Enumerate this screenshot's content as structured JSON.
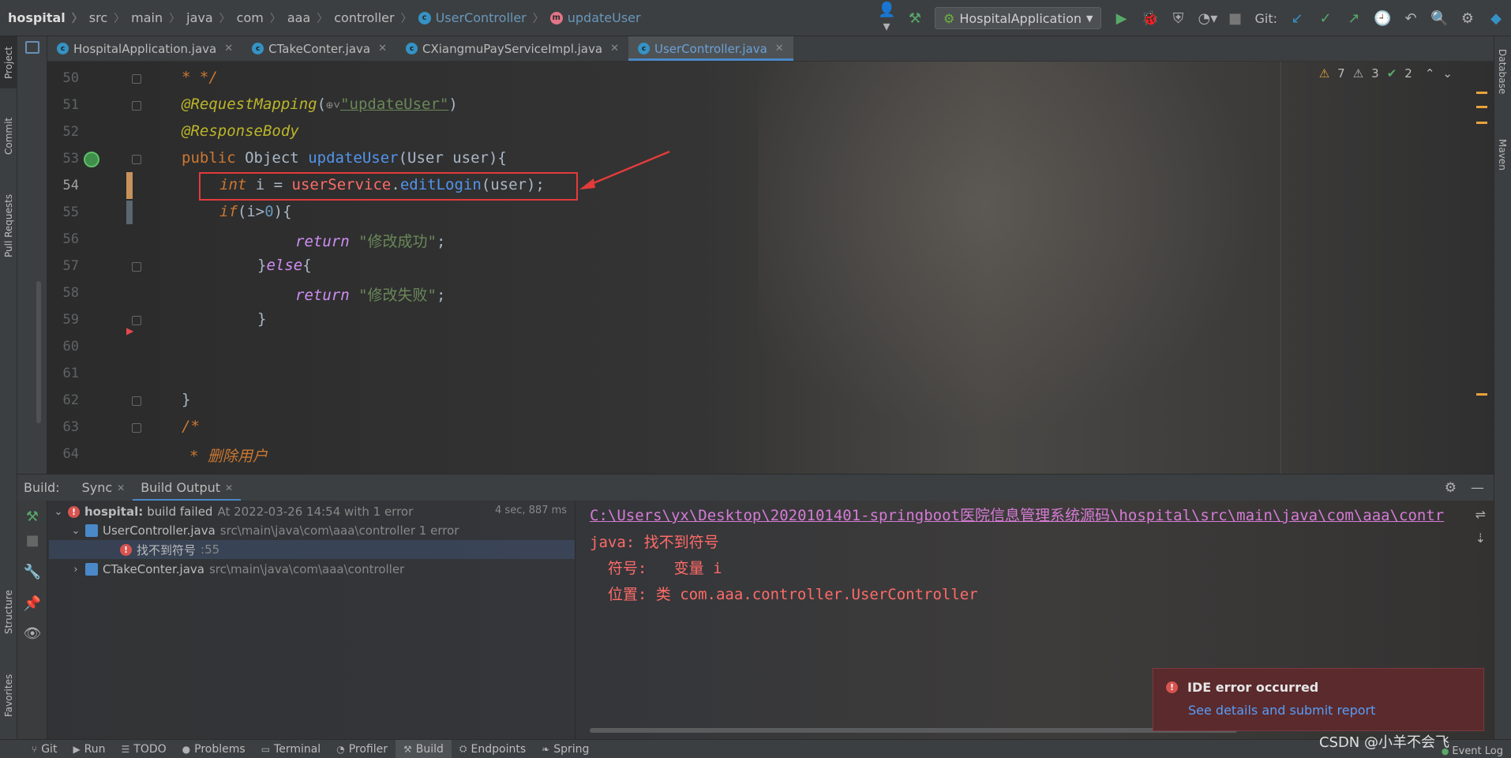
{
  "breadcrumb": {
    "items": [
      "hospital",
      "src",
      "main",
      "java",
      "com",
      "aaa",
      "controller"
    ],
    "class_item": "UserController",
    "method_item": "updateUser"
  },
  "toolbar": {
    "run_config": "HospitalApplication",
    "git_label": "Git:"
  },
  "editor_tabs": [
    {
      "label": "HospitalApplication.java"
    },
    {
      "label": "CTakeConter.java"
    },
    {
      "label": "CXiangmuPayServiceImpl.java"
    },
    {
      "label": "UserController.java",
      "active": true
    }
  ],
  "inspections": {
    "warnings": "7",
    "weak_warnings": "3",
    "ok": "2"
  },
  "editor": {
    "line_numbers": [
      "50",
      "51",
      "52",
      "53",
      "54",
      "55",
      "56",
      "57",
      "58",
      "59",
      "60",
      "61",
      "62",
      "63",
      "64"
    ],
    "lines": {
      "l50": "* */",
      "l51_ann": "@RequestMapping",
      "l51_str": "\"updateUser\"",
      "l52": "@ResponseBody",
      "l53_kw": "public",
      "l53_type": "Object",
      "l53_name": "updateUser",
      "l53_params": "(User user){",
      "l54_kw": "int",
      "l54_var": " i = ",
      "l54_obj": "userService",
      "l54_call": "editLogin",
      "l54_rest": "(user);",
      "l55_kw": "if",
      "l55_cond": "(i>",
      "l55_num": "0",
      "l55_end": "){",
      "l56_kw": "return",
      "l56_str": "\"修改成功\"",
      "l57": "}else{",
      "l57_kw": "else",
      "l58_kw": "return",
      "l58_str": "\"修改失败\"",
      "l59": "}",
      "l62": "}",
      "l63": "/*",
      "l64": "* 删除用户"
    }
  },
  "build": {
    "label": "Build:",
    "tabs": [
      {
        "label": "Sync"
      },
      {
        "label": "Build Output"
      }
    ],
    "tree": {
      "root_name": "hospital:",
      "root_status": "build failed",
      "root_meta": "At 2022-03-26 14:54 with 1 error",
      "root_time": "4 sec, 887 ms",
      "file1": "UserController.java",
      "file1_path": "src\\main\\java\\com\\aaa\\controller 1 error",
      "error_msg": "找不到符号",
      "error_line": ":55",
      "file2": "CTakeConter.java",
      "file2_path": "src\\main\\java\\com\\aaa\\controller"
    },
    "console": {
      "path": "C:\\Users\\yx\\Desktop\\2020101401-springboot医院信息管理系统源码\\hospital\\src\\main\\java\\com\\aaa\\contr",
      "line1": "java: 找不到符号",
      "line2": "  符号:   变量 i",
      "line3": "  位置: 类 com.aaa.controller.UserController"
    }
  },
  "toast": {
    "title": "IDE error occurred",
    "link": "See details and submit report"
  },
  "left_stripe": [
    "Project",
    "Commit",
    "Pull Requests",
    "Structure",
    "Favorites"
  ],
  "right_stripe": [
    "Database",
    "Maven"
  ],
  "bottom_bar": [
    {
      "label": "Git",
      "icon": "git-icon"
    },
    {
      "label": "Run",
      "icon": "run-icon"
    },
    {
      "label": "TODO",
      "icon": "todo-icon"
    },
    {
      "label": "Problems",
      "icon": "problems-icon"
    },
    {
      "label": "Terminal",
      "icon": "terminal-icon"
    },
    {
      "label": "Profiler",
      "icon": "profiler-icon"
    },
    {
      "label": "Build",
      "icon": "build-icon",
      "active": true
    },
    {
      "label": "Endpoints",
      "icon": "endpoints-icon"
    },
    {
      "label": "Spring",
      "icon": "spring-icon"
    }
  ],
  "watermark": "CSDN @小羊不会飞",
  "event_log": "Event Log",
  "colors": {
    "accent": "#4a88c7",
    "error": "#ff6b68",
    "toast_bg": "#5a2a2d",
    "highlight": "#e33b3b"
  }
}
